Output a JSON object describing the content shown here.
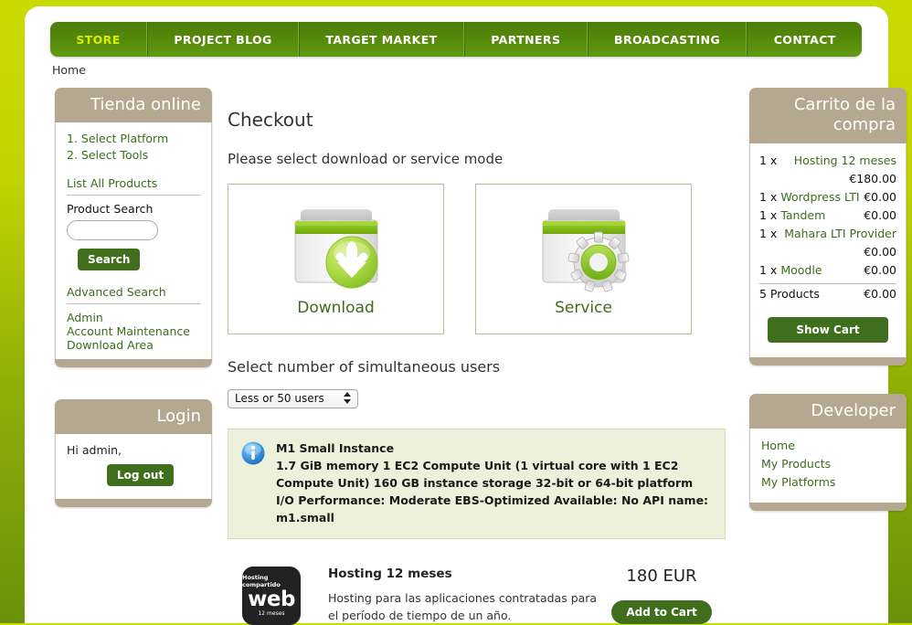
{
  "nav": {
    "items": [
      {
        "label": "STORE",
        "active": true
      },
      {
        "label": "PROJECT BLOG",
        "active": false
      },
      {
        "label": "TARGET MARKET",
        "active": false
      },
      {
        "label": "PARTNERS",
        "active": false
      },
      {
        "label": "BROADCASTING",
        "active": false
      },
      {
        "label": "CONTACT",
        "active": false
      }
    ]
  },
  "breadcrumb": "Home",
  "sidebar": {
    "store": {
      "title": "Tienda online",
      "steps": [
        "1. Select Platform",
        "2. Select Tools"
      ],
      "list_all_products": "List All Products",
      "product_search_label": "Product Search",
      "product_search_value": "",
      "product_search_placeholder": "",
      "search_button": "Search",
      "advanced_search": "Advanced Search",
      "links": [
        "Admin",
        "Account Maintenance",
        "Download Area"
      ]
    },
    "login": {
      "title": "Login",
      "greeting": "Hi admin,",
      "logout_button": "Log out"
    }
  },
  "cart": {
    "title": "Carrito de la compra",
    "items": [
      {
        "qty": "1 x",
        "name": "Hosting 12 meses",
        "price": "€180.00",
        "wrap": true
      },
      {
        "qty": "1 x",
        "name": "Wordpress LTI",
        "price": "€0.00",
        "wrap": false
      },
      {
        "qty": "1 x",
        "name": "Tandem",
        "price": "€0.00",
        "wrap": false
      },
      {
        "qty": "1 x",
        "name": "Mahara LTI Provider",
        "price": "€0.00",
        "wrap": true
      },
      {
        "qty": "1 x",
        "name": "Moodle",
        "price": "€0.00",
        "wrap": false
      }
    ],
    "total_label": "5 Products",
    "total_price": "€0.00",
    "show_cart_button": "Show Cart"
  },
  "developer": {
    "title": "Developer",
    "links": [
      "Home",
      "My Products",
      "My Platforms"
    ]
  },
  "main": {
    "page_title": "Checkout",
    "mode_prompt": "Please select download or service mode",
    "modes": [
      {
        "label": "Download",
        "icon": "download-folder-icon"
      },
      {
        "label": "Service",
        "icon": "service-gear-folder-icon"
      }
    ],
    "users_heading": "Select number of simultaneous users",
    "users_select_value": "Less or 50 users",
    "users_select_options": [
      "Less or 50 users"
    ],
    "info": {
      "icon": "info-icon",
      "title": "M1 Small Instance",
      "body": "1.7 GiB memory 1 EC2 Compute Unit (1 virtual core with 1 EC2 Compute Unit) 160 GB instance storage 32-bit or 64-bit platform I/O Performance: Moderate EBS-Optimized Available: No API name: m1.small"
    },
    "product": {
      "thumb_top": "Hosting compartido",
      "thumb_mid": "web",
      "thumb_bottom": "12 meses",
      "name": "Hosting 12 meses",
      "description": "Hosting para las aplicaciones contratadas para el período de tiempo de un año.",
      "price": "180 EUR",
      "add_button": "Add to Cart"
    }
  },
  "colors": {
    "page_background_top": "#c9da00",
    "page_background_bottom": "#6a920a",
    "nav_green": "#538609",
    "nav_active_text": "#d8f000",
    "panel_header_tan": "#b5a890",
    "link_green": "#3d6b1e",
    "button_green": "#3f6e1d",
    "info_box_background": "#edf1dc"
  }
}
